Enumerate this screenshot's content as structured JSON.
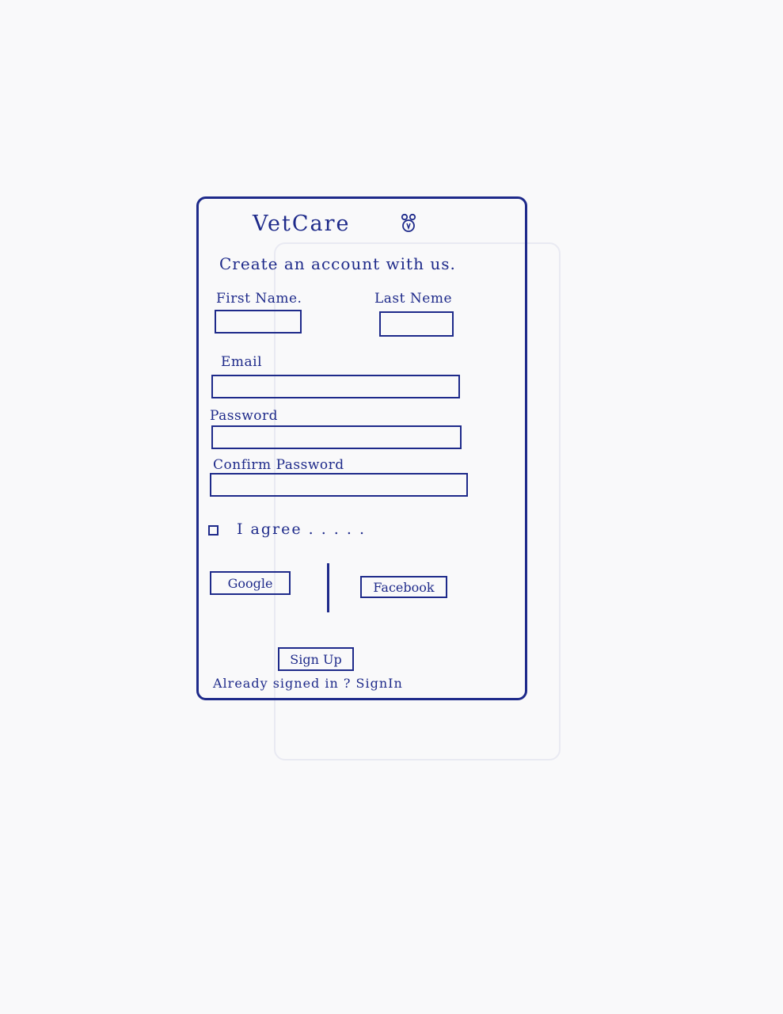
{
  "app": {
    "title": "VetCare"
  },
  "form": {
    "heading": "Create an account with us.",
    "first_name_label": "First Name.",
    "last_name_label": "Last Nеme",
    "email_label": "Email",
    "password_label": "Password",
    "confirm_password_label": "Confirm Password",
    "first_name_value": "",
    "last_name_value": "",
    "email_value": "",
    "password_value": "",
    "confirm_password_value": "",
    "agree_label": "I agree . . . . ."
  },
  "social": {
    "google_label": "Google",
    "facebook_label": "Facebook"
  },
  "actions": {
    "signup_label": "Sign Up",
    "signed_in_prompt": "Already signed in ?",
    "signin_link": "SignIn"
  },
  "icons": {
    "logo": "paw-icon"
  },
  "colors": {
    "ink": "#1e2a8a",
    "paper": "#f9f9fa"
  }
}
